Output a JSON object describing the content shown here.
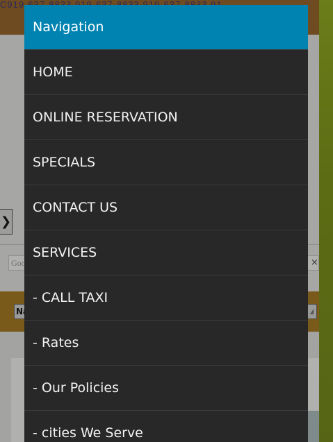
{
  "background": {
    "phone_line": "C919-637-8833  919-637-8833  919-637-8833  91",
    "google_placeholder": "Goo",
    "close_glyph": "×",
    "nav_select_text": "Na",
    "arrow_glyph": "❯"
  },
  "menu": {
    "title": "Navigation",
    "items": [
      {
        "label": "HOME"
      },
      {
        "label": "ONLINE RESERVATION"
      },
      {
        "label": "SPECIALS"
      },
      {
        "label": "CONTACT US"
      },
      {
        "label": "SERVICES"
      },
      {
        "label": "- CALL TAXI"
      },
      {
        "label": "- Rates"
      },
      {
        "label": "- Our Policies"
      },
      {
        "label": "- cities We Serve"
      }
    ]
  },
  "colors": {
    "menu_header_bg": "#0083b0",
    "menu_bg": "#282828",
    "menu_text": "#f2f2f2",
    "divider": "#3c3c3c"
  }
}
